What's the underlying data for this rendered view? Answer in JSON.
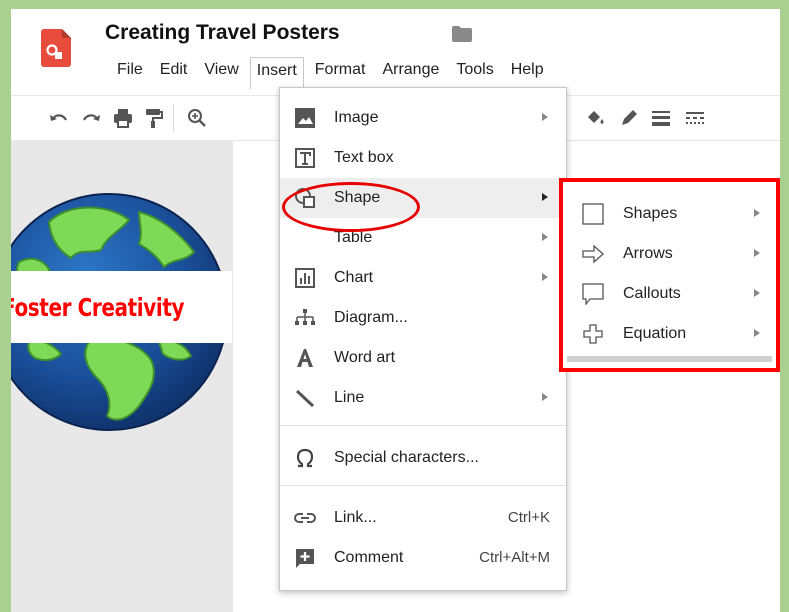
{
  "header": {
    "title": "Creating Travel Posters",
    "menus": [
      "File",
      "Edit",
      "View",
      "Insert",
      "Format",
      "Arrange",
      "Tools",
      "Help"
    ],
    "active_menu": "Insert"
  },
  "toolbar": {
    "left_icons": [
      "undo-icon",
      "redo-icon",
      "print-icon",
      "paint-format-icon",
      "zoom-icon"
    ],
    "right_icons": [
      "fill-color-icon",
      "border-color-icon",
      "border-weight-icon",
      "border-dash-icon"
    ]
  },
  "canvas": {
    "label_text": "Foster Creativity",
    "label_color": "#ff0000"
  },
  "insert_menu": {
    "items": [
      {
        "label": "Image",
        "icon": "image-icon",
        "submenu": true
      },
      {
        "label": "Text box",
        "icon": "text-box-icon",
        "submenu": false
      },
      {
        "label": "Shape",
        "icon": "shape-icon",
        "submenu": true,
        "highlighted": true
      },
      {
        "label": "Table",
        "icon": "",
        "submenu": true
      },
      {
        "label": "Chart",
        "icon": "chart-icon",
        "submenu": true
      },
      {
        "label": "Diagram...",
        "icon": "diagram-icon",
        "submenu": false
      },
      {
        "label": "Word art",
        "icon": "word-art-icon",
        "submenu": false
      },
      {
        "label": "Line",
        "icon": "line-icon",
        "submenu": true
      },
      {
        "label": "Special characters...",
        "icon": "omega-icon",
        "submenu": false
      },
      {
        "label": "Link...",
        "icon": "link-icon",
        "shortcut": "Ctrl+K"
      },
      {
        "label": "Comment",
        "icon": "comment-icon",
        "shortcut": "Ctrl+Alt+M"
      }
    ]
  },
  "shape_submenu": {
    "items": [
      {
        "label": "Shapes",
        "icon": "square-shape-icon"
      },
      {
        "label": "Arrows",
        "icon": "arrow-shape-icon"
      },
      {
        "label": "Callouts",
        "icon": "callout-shape-icon"
      },
      {
        "label": "Equation",
        "icon": "plus-shape-icon"
      }
    ]
  },
  "colors": {
    "accent_red": "#ff0000",
    "page_border_green": "#a9d08e",
    "logo_red": "#e74c3c"
  }
}
